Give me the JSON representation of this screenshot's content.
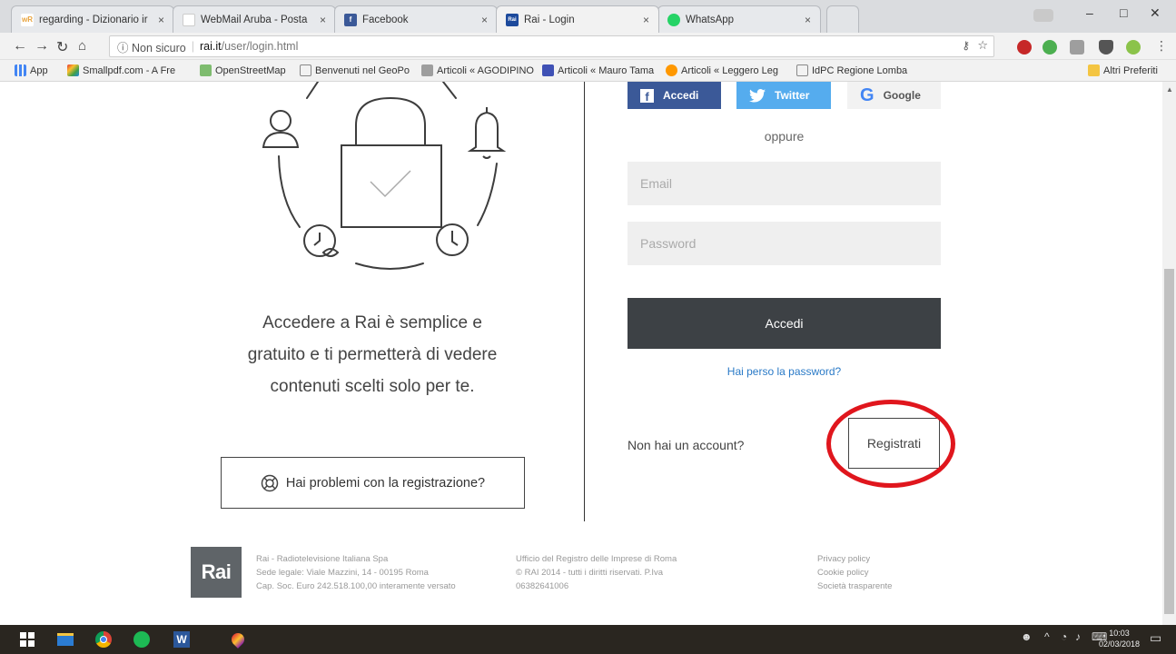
{
  "browser": {
    "tabs": [
      {
        "title": "regarding - Dizionario ir",
        "favicon_color": "#e8a33d",
        "favicon_text": "wR"
      },
      {
        "title": "WebMail Aruba - Posta",
        "favicon_color": "#e7e9ec",
        "favicon_text": ""
      },
      {
        "title": "Facebook",
        "favicon_color": "#3b5998",
        "favicon_text": "f"
      },
      {
        "title": "Rai - Login",
        "favicon_color": "#1d4a9c",
        "favicon_text": "Rai"
      },
      {
        "title": "WhatsApp",
        "favicon_color": "#25d366",
        "favicon_text": ""
      }
    ],
    "tab_close": "×",
    "window_controls": {
      "minimize": "–",
      "maximize": "□",
      "close": "✕"
    },
    "address": {
      "security": "ⓘ Non sicuro",
      "host": "rai.it",
      "path": "/user/login.html"
    },
    "bookmarks": [
      {
        "label": "App",
        "color": "#4285f4"
      },
      {
        "label": "Smallpdf.com - A Fre",
        "color": "#e53935"
      },
      {
        "label": "OpenStreetMap",
        "color": "#7ebc6f"
      },
      {
        "label": "Benvenuti nel GeoPo",
        "color": "#888888"
      },
      {
        "label": "Articoli « AGODIPINO",
        "color": "#9e9e9e"
      },
      {
        "label": "Articoli « Mauro Tama",
        "color": "#3f51b5"
      },
      {
        "label": "Articoli « Leggero Leg",
        "color": "#ff9800"
      },
      {
        "label": "IdPC Regione Lomba",
        "color": "#888888"
      }
    ],
    "other_bookmarks": "Altri Preferiti"
  },
  "login": {
    "social": {
      "facebook": "Accedi",
      "twitter": "Twitter",
      "google": "Google"
    },
    "or_text": "oppure",
    "email_placeholder": "Email",
    "password_placeholder": "Password",
    "submit": "Accedi",
    "forgot": "Hai perso la password?",
    "no_account": "Non hai un account?",
    "register": "Registrati"
  },
  "intro": {
    "line1": "Accedere a Rai è semplice e",
    "line2": "gratuito e ti permetterà di vedere",
    "line3": "contenuti scelti solo per te."
  },
  "problems_button": "Hai problemi con la registrazione?",
  "footer": {
    "logo": "Rai",
    "col1": [
      "Rai - Radiotelevisione Italiana Spa",
      "Sede legale: Viale Mazzini, 14 - 00195 Roma",
      "Cap. Soc. Euro 242.518.100,00 interamente versato"
    ],
    "col2": [
      "Ufficio del Registro delle Imprese di Roma",
      "© RAI 2014 - tutti i diritti riservati. P.Iva",
      "06382641006"
    ],
    "col3": [
      "Privacy policy",
      "Cookie policy",
      "Società trasparente"
    ]
  },
  "taskbar": {
    "time": "10:03",
    "date": "02/03/2018"
  }
}
